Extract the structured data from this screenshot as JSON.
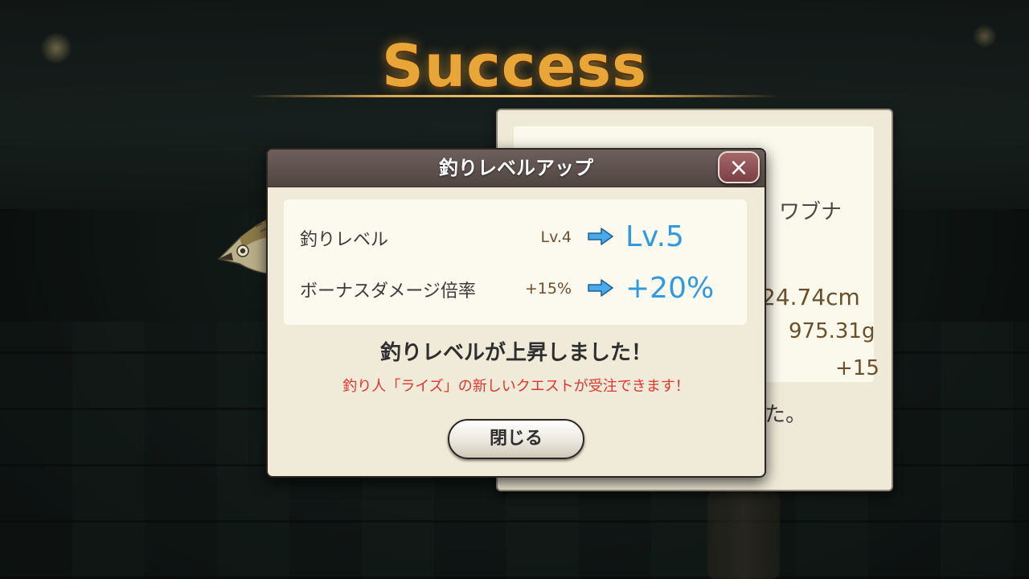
{
  "banner": {
    "title": "Success"
  },
  "back_panel": {
    "fish_name": "ワブナ",
    "length": "24.74cm",
    "weight": "975.31g",
    "bonus": "+15",
    "caught_text": "た。"
  },
  "modal": {
    "title": "釣りレベルアップ",
    "close_icon": "×",
    "stats": [
      {
        "label": "釣りレベル",
        "old": "Lv.4",
        "new": "Lv.5"
      },
      {
        "label": "ボーナスダメージ倍率",
        "old": "+15%",
        "new": "+20%"
      }
    ],
    "levelup_message": "釣りレベルが上昇しました！",
    "quest_message": "釣り人「ライズ」の新しいクエストが受注できます！",
    "close_button_label": "閉じる"
  },
  "colors": {
    "accent_blue": "#2f9ae0",
    "alert_red": "#e0342f",
    "title_gold": "#e9a638"
  }
}
